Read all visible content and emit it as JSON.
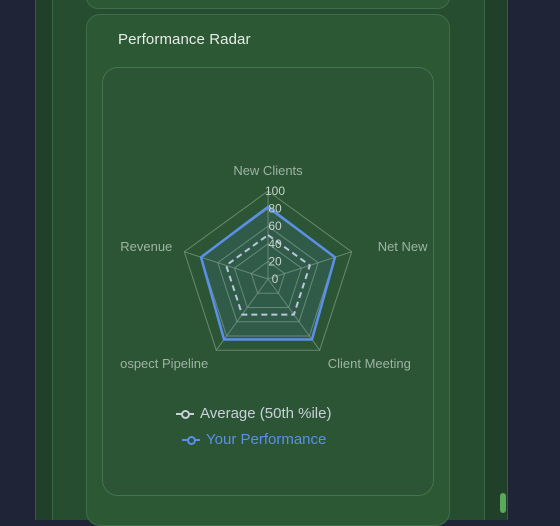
{
  "card": {
    "title": "Performance Radar"
  },
  "chart_data": {
    "type": "radar",
    "axes": [
      "New Clients",
      "Net New",
      "Client Meeting",
      "Prospect Pipeline",
      "Revenue"
    ],
    "axis_display": [
      "New Clients",
      "Net New",
      "Client Meeting",
      "ospect Pipeline",
      "Revenue"
    ],
    "r_ticks": [
      "0",
      "20",
      "40",
      "60",
      "80",
      "100"
    ],
    "r_range": [
      0,
      100
    ],
    "series": [
      {
        "name": "Average (50th %ile)",
        "values": [
          50,
          50,
          50,
          50,
          50
        ],
        "color": "#c9d0da",
        "dash": true
      },
      {
        "name": "Your Performance",
        "values": [
          82,
          80,
          85,
          85,
          80
        ],
        "color": "#5b8fe8",
        "dash": false
      }
    ],
    "legend_position": "bottom",
    "grid": true
  },
  "colors": {
    "accent": "#5b8fe8",
    "grid": "#7e9a7f",
    "label": "#9fb3a4"
  }
}
